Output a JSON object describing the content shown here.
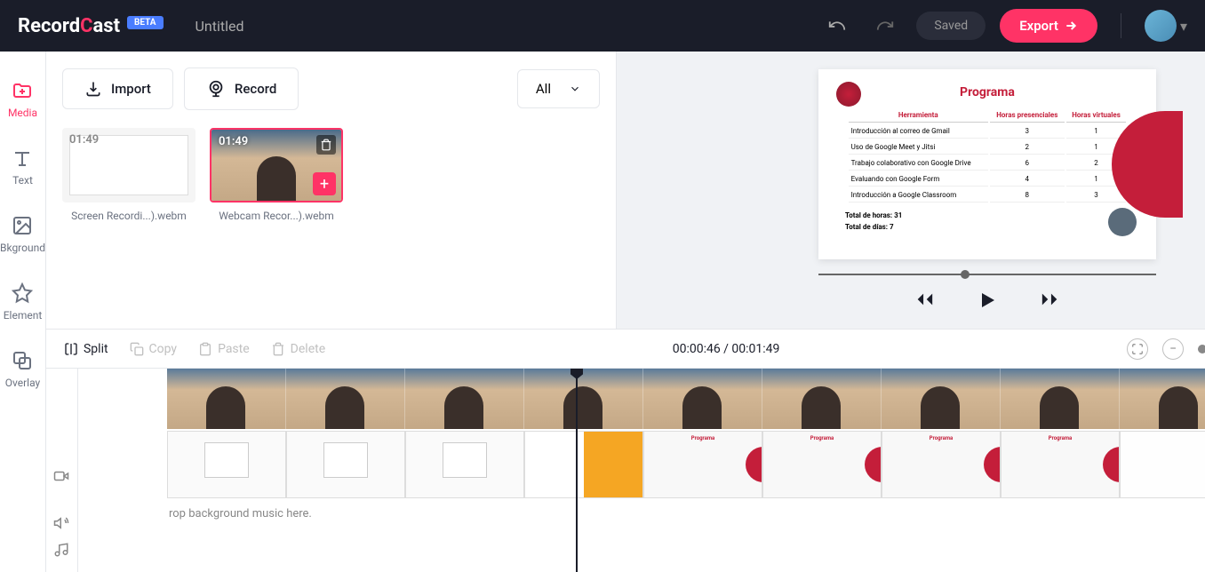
{
  "header": {
    "logo_record": "Record",
    "logo_ast": "ast",
    "beta": "BETA",
    "title": "Untitled",
    "saved": "Saved",
    "export": "Export"
  },
  "sidebar": {
    "items": [
      {
        "label": "Media"
      },
      {
        "label": "Text"
      },
      {
        "label": "Bkground"
      },
      {
        "label": "Element"
      },
      {
        "label": "Overlay"
      }
    ]
  },
  "media_panel": {
    "import_label": "Import",
    "record_label": "Record",
    "filter_label": "All",
    "items": [
      {
        "duration": "01:49",
        "name": "Screen Recordi...).webm"
      },
      {
        "duration": "01:49",
        "name": "Webcam Recor...).webm"
      }
    ]
  },
  "preview": {
    "title": "Programa",
    "headers": {
      "tool": "Herramienta",
      "pres": "Horas presenciales",
      "virt": "Horas virtuales"
    },
    "rows": [
      {
        "tool": "Introducción al correo de Gmail",
        "pres": "3",
        "virt": "1"
      },
      {
        "tool": "Uso de Google Meet y Jitsi",
        "pres": "2",
        "virt": "1"
      },
      {
        "tool": "Trabajo colaborativo con Google Drive",
        "pres": "6",
        "virt": "2"
      },
      {
        "tool": "Evaluando con Google Form",
        "pres": "4",
        "virt": "1"
      },
      {
        "tool": "Introducción a Google Classroom",
        "pres": "8",
        "virt": "3"
      }
    ],
    "total_hours": "Total de horas: 31",
    "total_days": "Total de días: 7"
  },
  "timeline_toolbar": {
    "split": "Split",
    "copy": "Copy",
    "paste": "Paste",
    "delete": "Delete",
    "time": "00:00:46 / 00:01:49"
  },
  "timeline": {
    "audio_hint": "rop background music here."
  }
}
